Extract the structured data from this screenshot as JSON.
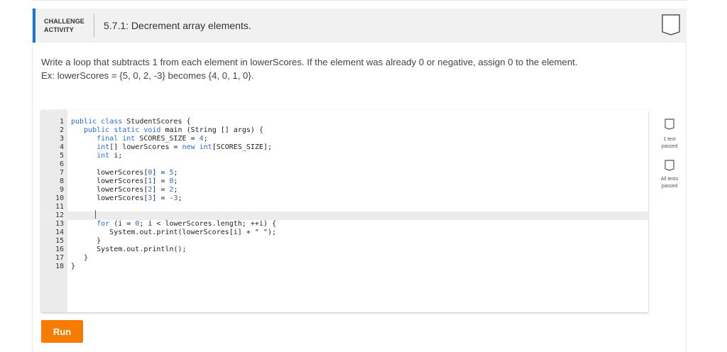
{
  "header": {
    "label_line1": "CHALLENGE",
    "label_line2": "ACTIVITY",
    "title": "5.7.1: Decrement array elements.",
    "accent_color": "#1976d2"
  },
  "description": {
    "line1": "Write a loop that subtracts 1 from each element in lowerScores. If the element was already 0 or negative, assign 0 to the element.",
    "line2": "Ex: lowerScores = {5, 0, 2, -3} becomes {4, 0, 1, 0}."
  },
  "editor": {
    "active_line": 12,
    "lines": [
      {
        "num": "1",
        "code": "public class StudentScores {"
      },
      {
        "num": "2",
        "code": "   public static void main (String [] args) {"
      },
      {
        "num": "3",
        "code": "      final int SCORES_SIZE = 4;"
      },
      {
        "num": "4",
        "code": "      int[] lowerScores = new int[SCORES_SIZE];"
      },
      {
        "num": "5",
        "code": "      int i;"
      },
      {
        "num": "6",
        "code": ""
      },
      {
        "num": "7",
        "code": "      lowerScores[0] = 5;"
      },
      {
        "num": "8",
        "code": "      lowerScores[1] = 0;"
      },
      {
        "num": "9",
        "code": "      lowerScores[2] = 2;"
      },
      {
        "num": "10",
        "code": "      lowerScores[3] = -3;"
      },
      {
        "num": "11",
        "code": ""
      },
      {
        "num": "12",
        "code": ""
      },
      {
        "num": "13",
        "code": "      for (i = 0; i < lowerScores.length; ++i) {"
      },
      {
        "num": "14",
        "code": "         System.out.print(lowerScores[i] + \" \");"
      },
      {
        "num": "15",
        "code": "      }"
      },
      {
        "num": "16",
        "code": "      System.out.println();"
      },
      {
        "num": "17",
        "code": "   }"
      },
      {
        "num": "18",
        "code": "}"
      }
    ]
  },
  "tests": {
    "test1_label_line1": "1 test",
    "test1_label_line2": "passed",
    "all_label_line1": "All tests",
    "all_label_line2": "passed"
  },
  "run_button": {
    "label": "Run",
    "color": "#f57c00"
  }
}
